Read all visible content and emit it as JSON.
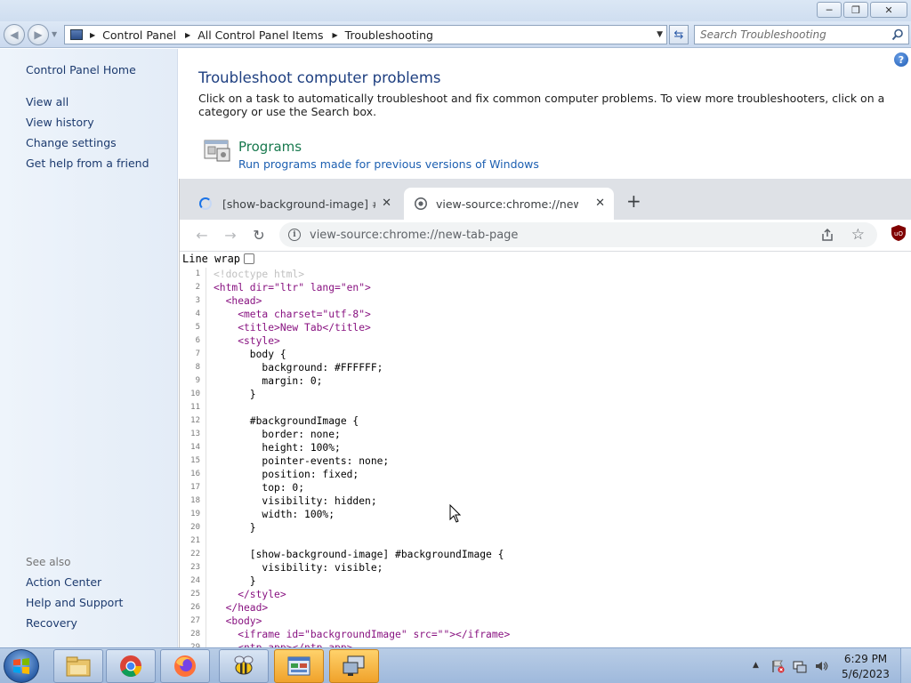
{
  "explorer": {
    "breadcrumbs": [
      "Control Panel",
      "All Control Panel Items",
      "Troubleshooting"
    ],
    "search_placeholder": "Search Troubleshooting",
    "left_pane": {
      "home": "Control Panel Home",
      "links": [
        "View all",
        "View history",
        "Change settings",
        "Get help from a friend"
      ],
      "see_also_heading": "See also",
      "see_also": [
        "Action Center",
        "Help and Support",
        "Recovery"
      ]
    },
    "main": {
      "title": "Troubleshoot computer problems",
      "description": "Click on a task to automatically troubleshoot and fix common computer problems. To view more troubleshooters, click on a category or use the Search box.",
      "category_title": "Programs",
      "category_link": "Run programs made for previous versions of Windows"
    }
  },
  "chrome": {
    "tabs": [
      {
        "title": "[show-background-image] #backgroundImage",
        "loading": true
      },
      {
        "title": "view-source:chrome://new-tab-page",
        "active": true
      }
    ],
    "url": "view-source:chrome://new-tab-page",
    "line_wrap_label": "Line wrap",
    "line_wrap_checked": false,
    "source_lines": [
      "<!doctype html>",
      "<html dir=\"ltr\" lang=\"en\">",
      "  <head>",
      "    <meta charset=\"utf-8\">",
      "    <title>New Tab</title>",
      "    <style>",
      "      body {",
      "        background: #FFFFFF;",
      "        margin: 0;",
      "      }",
      "",
      "      #backgroundImage {",
      "        border: none;",
      "        height: 100%;",
      "        pointer-events: none;",
      "        position: fixed;",
      "        top: 0;",
      "        visibility: hidden;",
      "        width: 100%;",
      "      }",
      "",
      "      [show-background-image] #backgroundImage {",
      "        visibility: visible;",
      "      }",
      "    </style>",
      "  </head>",
      "  <body>",
      "    <iframe id=\"backgroundImage\" src=\"\"></iframe>",
      "    <ntp-app></ntp-app>"
    ]
  },
  "taskbar": {
    "time": "6:29 PM",
    "date": "5/6/2023",
    "apps": [
      "explorer-icon",
      "chrome-icon",
      "firefox-icon",
      "bee-app-icon",
      "control-panel-icon",
      "remote-desktop-icon"
    ]
  },
  "colors": {
    "explorer_link": "#1c3a6e",
    "category_green": "#18794e",
    "title_blue": "#1e3f80",
    "source_tag": "#881280"
  }
}
